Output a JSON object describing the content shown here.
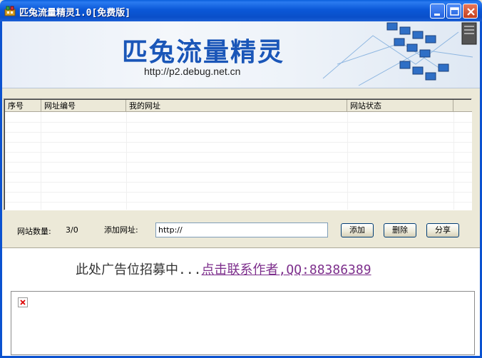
{
  "window": {
    "title": "匹兔流量精灵1.0[免费版]"
  },
  "banner": {
    "title": "匹兔流量精灵",
    "url": "http://p2.debug.net.cn"
  },
  "table": {
    "columns": [
      "序号",
      "网址编号",
      "我的网址",
      "网站状态"
    ],
    "rows": []
  },
  "controls": {
    "site_count_label": "网站数量:",
    "site_count_value": "3/0",
    "add_url_label": "添加网址:",
    "url_input_value": "http://",
    "add_button": "添加",
    "delete_button": "删除",
    "share_button": "分享"
  },
  "ad": {
    "text": "此处广告位招募中...",
    "link_text": "点击联系作者,QQ:88386389"
  },
  "colors": {
    "titlebar": "#0a58d8",
    "banner_title": "#1a56b8",
    "ad_link": "#7d2f8c"
  }
}
